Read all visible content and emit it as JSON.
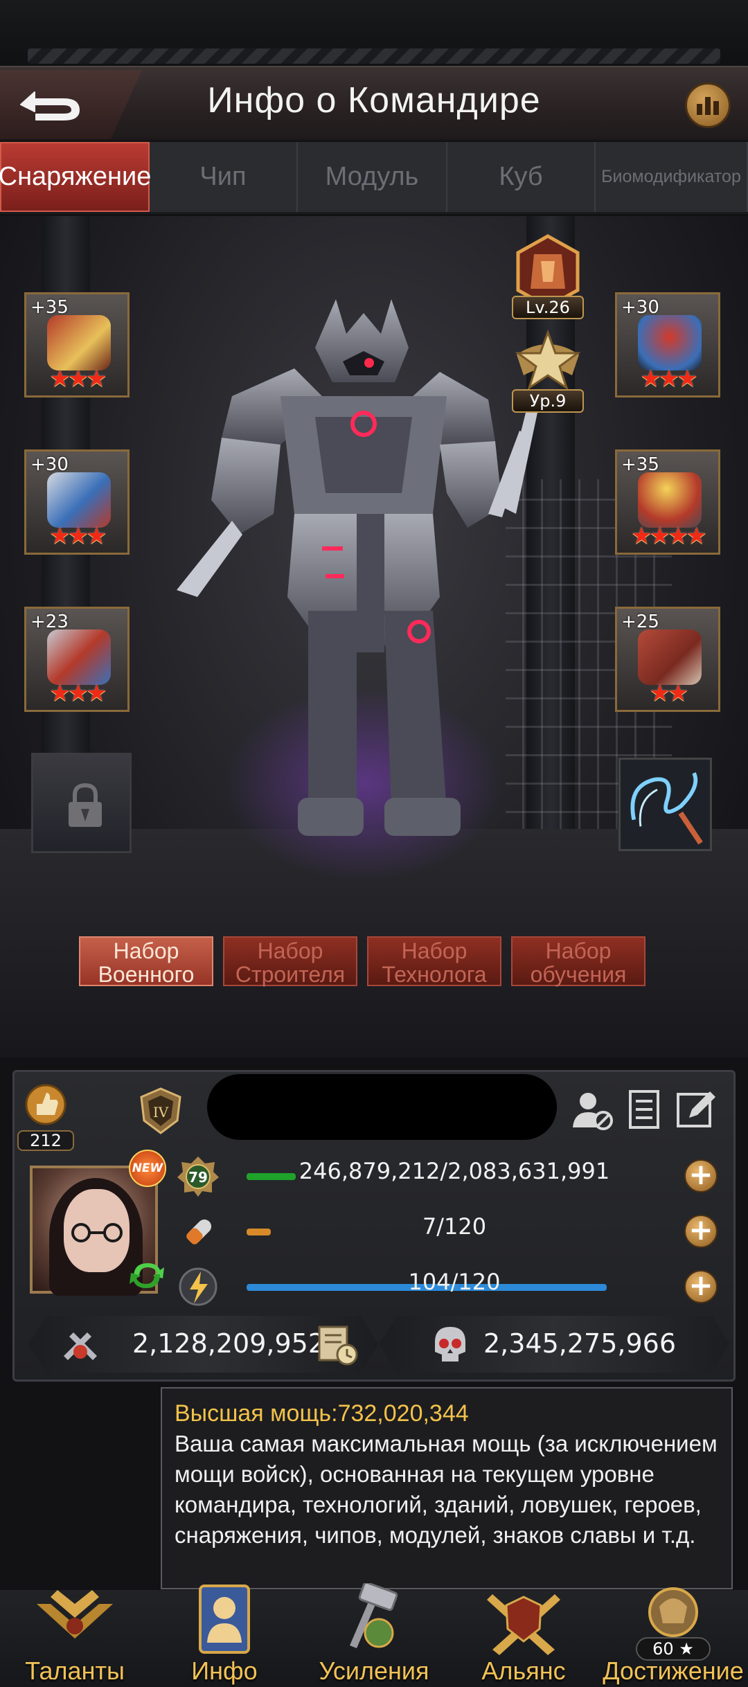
{
  "header": {
    "title": "Инфо о Командире"
  },
  "tabs": [
    {
      "label": "Снаряжение",
      "active": true
    },
    {
      "label": "Чип",
      "active": false
    },
    {
      "label": "Модуль",
      "active": false
    },
    {
      "label": "Куб",
      "active": false
    },
    {
      "label": "Биомодификатор",
      "active": false
    }
  ],
  "equipment": {
    "left": [
      {
        "level": "+35",
        "stars": "★★★",
        "item": "gauntlet"
      },
      {
        "level": "+30",
        "stars": "★★★",
        "item": "arm-guard"
      },
      {
        "level": "+23",
        "stars": "★★★",
        "item": "chest-armor"
      }
    ],
    "right": [
      {
        "level": "+30",
        "stars": "★★★",
        "item": "helmet"
      },
      {
        "level": "+35",
        "stars": "★★★★",
        "item": "ring"
      },
      {
        "level": "+25",
        "stars": "★★",
        "item": "boots"
      }
    ],
    "locked_slot": "lock-icon",
    "special_slot": "lightning-weapon"
  },
  "badges": {
    "armor_level": "Lv.26",
    "rank_level": "Ур.9"
  },
  "kits": [
    {
      "label": "Набор\nВоенного",
      "active": true
    },
    {
      "label": "Набор\nСтроителя",
      "active": false
    },
    {
      "label": "Набор\nТехнолога",
      "active": false
    },
    {
      "label": "Набор\nобучения",
      "active": false
    }
  ],
  "commander": {
    "rank_count": "212",
    "level": "79",
    "new_badge": "NEW",
    "stats": [
      {
        "icon": "level-icon",
        "value": "246,879,212/2,083,631,991",
        "fraction": 0.118,
        "color": "#1fa32a"
      },
      {
        "icon": "stamina-icon",
        "value": "7/120",
        "fraction": 0.058,
        "color": "#d88a2a"
      },
      {
        "icon": "energy-icon",
        "value": "104/120",
        "fraction": 0.867,
        "color": "#2c8ad8"
      }
    ],
    "power": "2,128,209,952",
    "kills": "2,345,275,966"
  },
  "tooltip": {
    "title": "Высшая мощь:732,020,344",
    "body": "Ваша самая максимальная мощь (за исключением мощи войск), основанная на текущем уровне командира, технологий, зданий, ловушек, героев, снаряжения, чипов, модулей, знаков славы и т.д."
  },
  "nav": [
    {
      "label": "Таланты",
      "icon": "talents-icon"
    },
    {
      "label": "Инфо",
      "icon": "info-icon"
    },
    {
      "label": "Усиления",
      "icon": "boosts-icon"
    },
    {
      "label": "Альянс",
      "icon": "alliance-icon"
    },
    {
      "label": "Достижение",
      "icon": "achievement-icon",
      "count": "60 ★"
    }
  ]
}
